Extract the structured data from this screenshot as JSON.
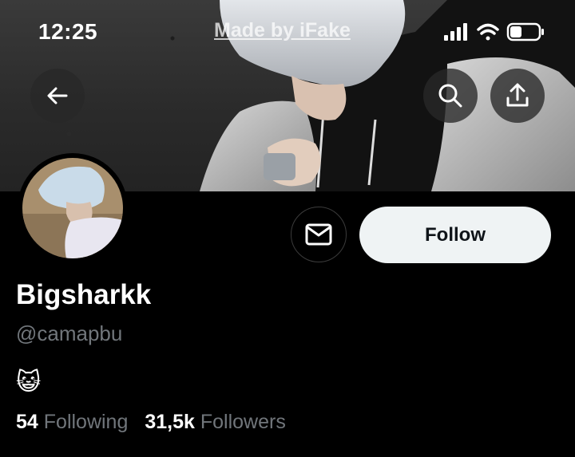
{
  "status_bar": {
    "time": "12:25",
    "watermark": "Made by iFake",
    "icons": [
      "signal-icon",
      "wifi-icon",
      "battery-icon"
    ]
  },
  "header": {
    "back_icon": "arrow-left-icon",
    "search_icon": "search-icon",
    "share_icon": "share-icon"
  },
  "profile": {
    "display_name": "Bigsharkk",
    "handle": "@camapbu",
    "bio": "😺",
    "following_count": "54",
    "following_label": "Following",
    "followers_count": "31,5k",
    "followers_label": "Followers"
  },
  "actions": {
    "message_icon": "envelope-icon",
    "follow_label": "Follow"
  },
  "colors": {
    "background": "#000000",
    "secondary_text": "#71767b",
    "follow_button_bg": "#eff3f4",
    "follow_button_text": "#0f1419"
  }
}
